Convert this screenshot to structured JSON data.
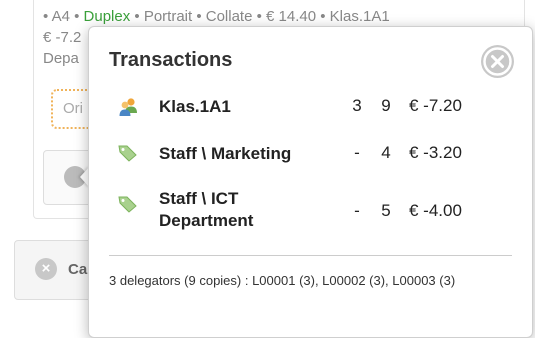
{
  "background": {
    "summary_line": {
      "parts": [
        "• A4 • ",
        "Duplex",
        " • Portrait • Collate • € 14.40 • Klas.1A1"
      ]
    },
    "line2": "€ -7.2",
    "line3": "Depa",
    "original_label": "Ori",
    "cancel_label": "Ca"
  },
  "popover": {
    "title": "Transactions",
    "rows": [
      {
        "icon": "user-group-icon",
        "name": "Klas.1A1",
        "col1": "3",
        "col2": "9",
        "amount": "€ -7.20"
      },
      {
        "icon": "tag-icon",
        "name": "Staff \\ Marketing",
        "col1": "-",
        "col2": "4",
        "amount": "€ -3.20"
      },
      {
        "icon": "tag-icon",
        "name_lines": [
          "Staff \\ ICT",
          "Department"
        ],
        "col1": "-",
        "col2": "5",
        "amount": "€ -4.00"
      }
    ],
    "footer": "3 delegators (9 copies) : L00001 (3), L00002 (3), L00003 (3)"
  },
  "colors": {
    "duplex": "#3aa03a",
    "close_button": "#c8c8c8",
    "original_border": "#f0b35a"
  }
}
